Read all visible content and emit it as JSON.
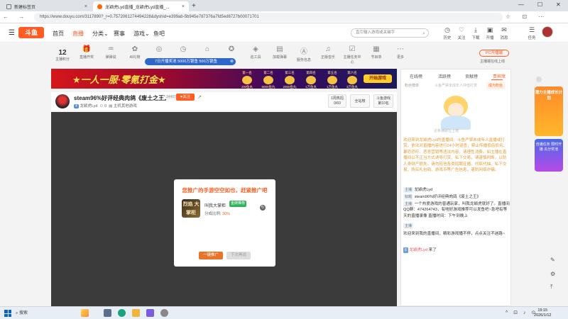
{
  "browser": {
    "tabs": [
      {
        "label": "新建标签页"
      },
      {
        "label": "龙颖虎Lyd直播_龙颖虎Lyd直播_..."
      }
    ],
    "new_tab": "+",
    "window_controls": [
      "—",
      "☐",
      "✕"
    ],
    "url": "https://www.douyu.com/3117890?_r=0.7572061274494228&dyshid=e399ab-5b945e787376a7fd5ed6727b00071701",
    "nav_glyphs": "← → ⟳",
    "addr_icons": "☆ ⊡ ⋯"
  },
  "site": {
    "logo": "斗鱼",
    "nav": [
      "首页",
      "直播",
      "分类",
      "赛事",
      "游戏",
      "鱼吧"
    ],
    "search_placeholder": "直引输入游戏或关键字",
    "header_icons": [
      {
        "label": "历史",
        "glyph": "◷"
      },
      {
        "label": "关注",
        "glyph": "♡"
      },
      {
        "label": "下载",
        "glyph": "⤓"
      },
      {
        "label": "开播",
        "glyph": "▣"
      },
      {
        "label": "消息",
        "glyph": "✉"
      },
      {
        "label": "任务",
        "glyph": "☰"
      }
    ]
  },
  "toolbar": {
    "points_value": "12",
    "points_label": "主播积分",
    "items": [
      {
        "label": "直播开奖",
        "glyph": "🎁"
      },
      {
        "label": "弹弹说",
        "glyph": "♒"
      },
      {
        "label": "AI礼物",
        "glyph": "✿"
      },
      {
        "label": "",
        "glyph": "◎"
      },
      {
        "label": "",
        "glyph": "◷"
      },
      {
        "label": "",
        "glyph": "⌂"
      },
      {
        "label": "",
        "glyph": "✪"
      },
      {
        "label": "巡工具",
        "glyph": "◈"
      },
      {
        "label": "加载弹幕",
        "glyph": "▤"
      },
      {
        "label": "服务信息",
        "glyph": "Ⓐ"
      },
      {
        "label": "正版音乐",
        "glyph": "♫"
      },
      {
        "label": "主播任务中心",
        "glyph": "☑"
      },
      {
        "label": "节目单",
        "glyph": "▦"
      },
      {
        "label": "更多",
        "glyph": "⋯"
      }
    ],
    "promo_pill": "7日开播奖池 5000万银鱼 500万银鱼",
    "pc_button": "PC开播端",
    "pc_sub": "主播端在线上线"
  },
  "banner": {
    "headline": "★一人一服·零氪打金★",
    "prizes": [
      {
        "rank": "第一名",
        "reward": "2W鱼丸"
      },
      {
        "rank": "第二名",
        "reward": "5000鱼丸"
      },
      {
        "rank": "第三名",
        "reward": "2000鱼丸"
      },
      {
        "rank": "第四名",
        "reward": "1万鱼丸"
      },
      {
        "rank": "第五名",
        "reward": "1万鱼丸"
      },
      {
        "rank": "第六名",
        "reward": "3万鱼丸"
      }
    ],
    "start_button": "开始游戏"
  },
  "streamer": {
    "title": "steam96%好评经典肉鸽《废土之王》",
    "hot": "34407",
    "follow": "关注",
    "share_glyph": "↗",
    "name": "龙颖虎Lyd",
    "level": "4",
    "count": "0",
    "category": "主机其他游戏",
    "btn_rank": "1周热招",
    "btn_rank_sub": "0/60",
    "btn_all": "全站榜",
    "btn_rank2": "斗鱼游戏",
    "btn_rank2_sub": "第10名"
  },
  "popup": {
    "title": "您推广的手游空空如也，赶紧推广吧",
    "game_icon_text": "烈焰 大掌柜",
    "game_name": "叫我大掌柜",
    "game_badge": "金牌推荐",
    "ratio_label": "分成比例: ",
    "ratio_value": "30%",
    "promote_button": "一键推广",
    "later_button": "下次再说"
  },
  "right_panel": {
    "tabs": [
      "在线榜",
      "活跃榜",
      "贡献榜",
      "贵宾席"
    ],
    "rank_left": "粉丝榜单",
    "rank_mid": "斗鱼严禁未成年人冲值打赏",
    "rank_right": "成为粉丝",
    "anime_caption": "近条播就在上榜",
    "system_msg": "欢迎来到龙颖虎Lyd的直播间。斗鱼严禁未成年人直播或打赏，依法对直播内容进行24小时巡查，禁止传播低俗低劣、暴恐恐吓、恶意营销等违法内容，请理性消费。如主播在直播间以不正当方式诱导打赏、私下交易，请谨慎判断，以防人身财产损失。请勿轻信各类招聘征婚、代练代抽、私下交易、购买礼包码、游戏币等广告信息，谨防网络诈骗。",
    "line1_tag": "主播",
    "line1_text": "龙颖虎Lyd",
    "line2_tag": "标题",
    "line2_text": "steam96%好评经典肉鸽《废土之王》",
    "line3_tag": "主播",
    "line3_text": "一个热爱游戏的普通玩家，叫我龙颖虎就好了。直播间QQ群：474264743，有啥好游戏推荐可以发鱼吧~急吧有等天的直播录像 直播时间：下午到晚上",
    "line4_tag": "主播",
    "line5_text": "欢迎来到我的直播间，精彩游戏播不停，点点关注不迷路~",
    "chat_level": "6",
    "chat_user": "龙颖虎Lyd",
    "chat_action": "来了"
  },
  "side_ads": {
    "ad1": "潜力主播成长计划",
    "ad2": "自播任务 限时开播 瓜分奖池"
  },
  "taskbar": {
    "search": "搜索",
    "time": "19:15",
    "date": "2026/1/12",
    "tray": "^ ⊡ ♪ ⊙"
  }
}
